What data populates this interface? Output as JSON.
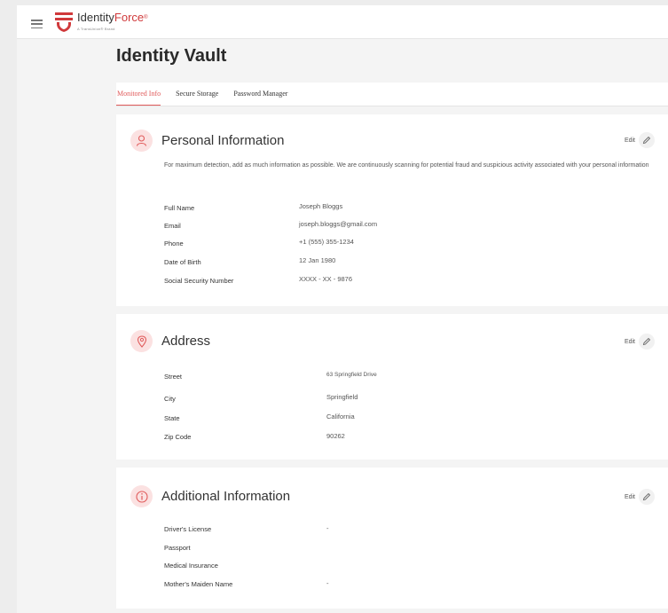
{
  "brand": {
    "name_part1": "Identity",
    "name_part2": "Force",
    "trademark": "®",
    "tagline": "A TransUnion® Brand",
    "accent": "#d0393b"
  },
  "page": {
    "title": "Identity Vault"
  },
  "tabs": [
    {
      "label": "Monitored Info",
      "active": true
    },
    {
      "label": "Secure Storage",
      "active": false
    },
    {
      "label": "Password Manager",
      "active": false
    }
  ],
  "cards": {
    "personal": {
      "title": "Personal Information",
      "icon": "person-icon",
      "edit_label": "Edit",
      "description": "For maximum detection, add as much information as possible. We are continuously scanning for potential fraud and suspicious activity associated with your personal information",
      "fields": [
        {
          "label": "Full Name",
          "value": "Joseph Bloggs"
        },
        {
          "label": "Email",
          "value": "joseph.bloggs@gmail.com"
        },
        {
          "label": "Phone",
          "value": "+1 (555) 355-1234"
        },
        {
          "label": "Date of Birth",
          "value": "12 Jan 1980"
        },
        {
          "label": "Social Security Number",
          "value": "XXXX - XX - 9876"
        }
      ]
    },
    "address": {
      "title": "Address",
      "icon": "location-pin-icon",
      "edit_label": "Edit",
      "fields": [
        {
          "label": "Street",
          "value": "63 Springfield Drive"
        },
        {
          "label": "City",
          "value": "Springfield"
        },
        {
          "label": "State",
          "value": "California"
        },
        {
          "label": "Zip Code",
          "value": "90262"
        }
      ]
    },
    "additional": {
      "title": "Additional Information",
      "icon": "info-icon",
      "edit_label": "Edit",
      "fields": [
        {
          "label": "Driver's License",
          "value": "-"
        },
        {
          "label": "Passport",
          "value": ""
        },
        {
          "label": "Medical Insurance",
          "value": ""
        },
        {
          "label": "Mother's Maiden Name",
          "value": "-"
        }
      ]
    }
  }
}
